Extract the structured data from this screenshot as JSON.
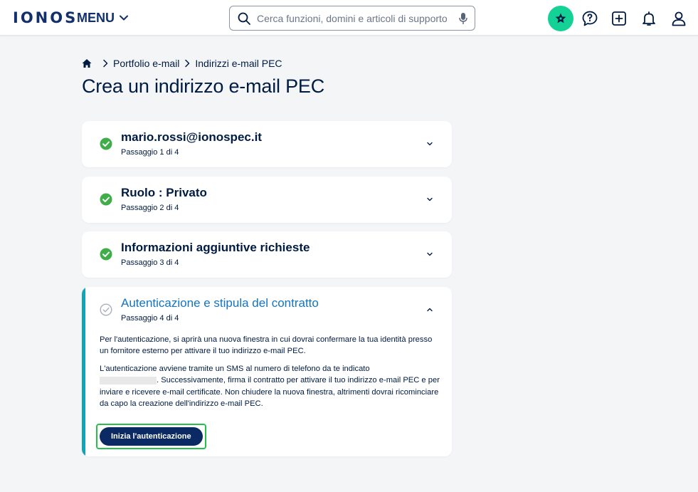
{
  "header": {
    "logo": "IONOS",
    "menu_label": "MENU",
    "search_placeholder": "Cerca funzioni, domini e articoli di supporto",
    "icons": [
      "search-icon",
      "mic-icon",
      "star-icon",
      "help-icon",
      "plus-icon",
      "bell-icon",
      "user-icon"
    ],
    "accent_color": "#14d296"
  },
  "breadcrumb": {
    "items": [
      "Portfolio e-mail",
      "Indirizzi e-mail PEC"
    ]
  },
  "page": {
    "title": "Crea un indirizzo e-mail PEC"
  },
  "steps": [
    {
      "title": "mario.rossi@ionospec.it",
      "subtitle": "Passaggio 1 di 4",
      "status": "completed"
    },
    {
      "title": "Ruolo : Privato",
      "subtitle": "Passaggio 2 di 4",
      "status": "completed"
    },
    {
      "title": "Informazioni aggiuntive richieste",
      "subtitle": "Passaggio 3 di 4",
      "status": "completed"
    },
    {
      "title": "Autenticazione e stipula del contratto",
      "subtitle": "Passaggio 4 di 4",
      "status": "active",
      "paragraph1": "Per l'autenticazione, si aprirà una nuova finestra in cui dovrai confermare la tua identità presso un fornitore esterno per attivare il tuo indirizzo e-mail PEC.",
      "paragraph2_a": "L'autenticazione avviene tramite un SMS al numero di telefono da te indicato",
      "paragraph2_b": ". Successivamente, firma il contratto per attivare il tuo indirizzo e-mail PEC e per inviare e ricevere e-mail certificate. Non chiudere la nuova finestra, altrimenti dovrai ricominciare da capo la creazione dell'indirizzo e-mail PEC.",
      "button_label": "Inizia l'autenticazione"
    }
  ],
  "colors": {
    "completed": "#3fae49",
    "active_accent": "#0fa4b8",
    "active_title": "#1474c4",
    "primary_button": "#0b2a63",
    "focus_outline": "#23c14a"
  }
}
